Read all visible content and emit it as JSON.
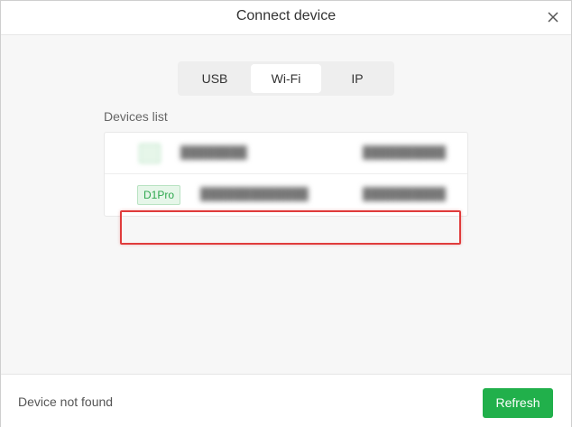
{
  "dialog": {
    "title": "Connect device",
    "close_icon": "close-icon"
  },
  "tabs": [
    {
      "label": "USB",
      "active": false
    },
    {
      "label": "Wi-Fi",
      "active": true
    },
    {
      "label": "IP",
      "active": false
    }
  ],
  "devices": {
    "label": "Devices list",
    "items": [
      {
        "badge": "",
        "name": "",
        "ip": ""
      },
      {
        "badge": "D1Pro",
        "name": "",
        "ip": "",
        "highlighted": true
      }
    ]
  },
  "footer": {
    "status": "Device not found",
    "refresh_label": "Refresh"
  },
  "colors": {
    "accent": "#21b04b",
    "highlight": "#e03c3c",
    "badge_text": "#2fa84f"
  }
}
